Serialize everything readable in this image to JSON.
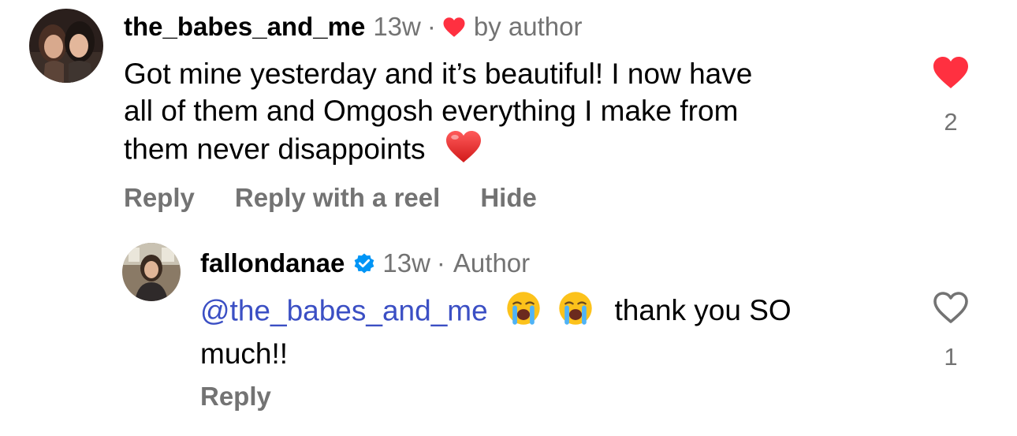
{
  "comments": [
    {
      "username": "the_babes_and_me",
      "time": "13w",
      "separator": "·",
      "by_author": "by author",
      "lines": [
        "Got mine yesterday and it’s beautiful! I now have",
        "all of them and Omgosh everything I make from",
        "them never disappoints"
      ],
      "trailing_emoji": "red-heart-emoji",
      "actions": [
        "Reply",
        "Reply with a reel",
        "Hide"
      ],
      "like_count": "2",
      "liked": true
    },
    {
      "username": "fallondanae",
      "verified": true,
      "time": "13w",
      "separator": "·",
      "author_tag": "Author",
      "mention": "@the_babes_and_me",
      "emojis": [
        "loudly-crying-face-emoji",
        "loudly-crying-face-emoji"
      ],
      "text_after": "thank you SO",
      "text_line2": "much!!",
      "actions": [
        "Reply"
      ],
      "like_count": "1",
      "liked": false
    }
  ],
  "colors": {
    "heart_red": "#ff3040",
    "meta_gray": "#737373",
    "mention_blue": "#3b4fc4",
    "verified_blue": "#0095f6"
  }
}
